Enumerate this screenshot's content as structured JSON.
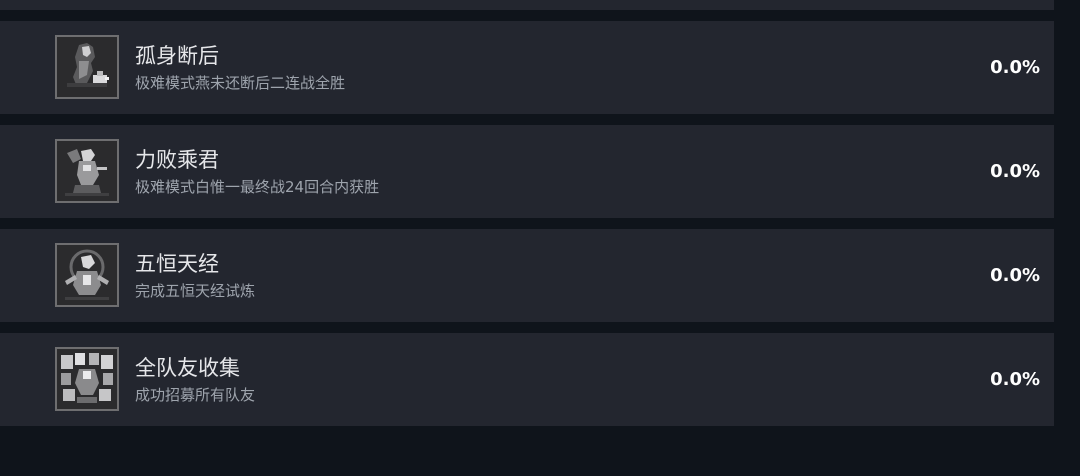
{
  "achievements": [
    {
      "icon": "swordswoman-with-beast-icon",
      "title": "孤身断后",
      "description": "极难模式燕未还断后二连战全胜",
      "percent": "0.0%"
    },
    {
      "icon": "kneeling-warrior-icon",
      "title": "力败乘君",
      "description": "极难模式白惟一最终战24回合内获胜",
      "percent": "0.0%"
    },
    {
      "icon": "five-constants-sage-icon",
      "title": "五恒天经",
      "description": "完成五恒天经试炼",
      "percent": "0.0%"
    },
    {
      "icon": "party-group-icon",
      "title": "全队友收集",
      "description": "成功招募所有队友",
      "percent": "0.0%"
    }
  ]
}
